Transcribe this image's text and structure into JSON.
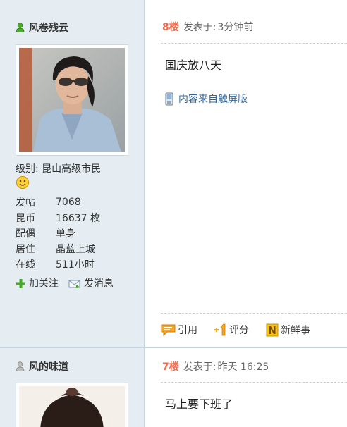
{
  "posts": [
    {
      "author": {
        "name": "风卷残云",
        "level_label": "级别:",
        "level_value": "昆山高级市民",
        "stats": [
          {
            "label": "发帖",
            "value": "7068"
          },
          {
            "label": "昆币",
            "value": "16637 枚"
          },
          {
            "label": "配偶",
            "value": "单身"
          },
          {
            "label": "居住",
            "value": "晶蓝上城"
          },
          {
            "label": "在线",
            "value": "511小时"
          }
        ],
        "follow_label": "加关注",
        "message_label": "发消息"
      },
      "floor": "8楼",
      "posted_label": "发表于:",
      "posted_time": "3分钟前",
      "content": "国庆放八天",
      "source_label": "内容来自触屏版",
      "actions": {
        "quote_label": "引用",
        "rate_label": "评分",
        "news_label": "新鲜事"
      }
    },
    {
      "author": {
        "name": "风的味道"
      },
      "floor": "7楼",
      "posted_label": "发表于:",
      "posted_time": "昨天 16:25",
      "content": "马上要下班了"
    }
  ],
  "colors": {
    "sidebar_bg": "#e5edf2",
    "sidebar_border": "#c2d5e3",
    "floor_color": "#f26c4f",
    "link_color": "#336699"
  }
}
